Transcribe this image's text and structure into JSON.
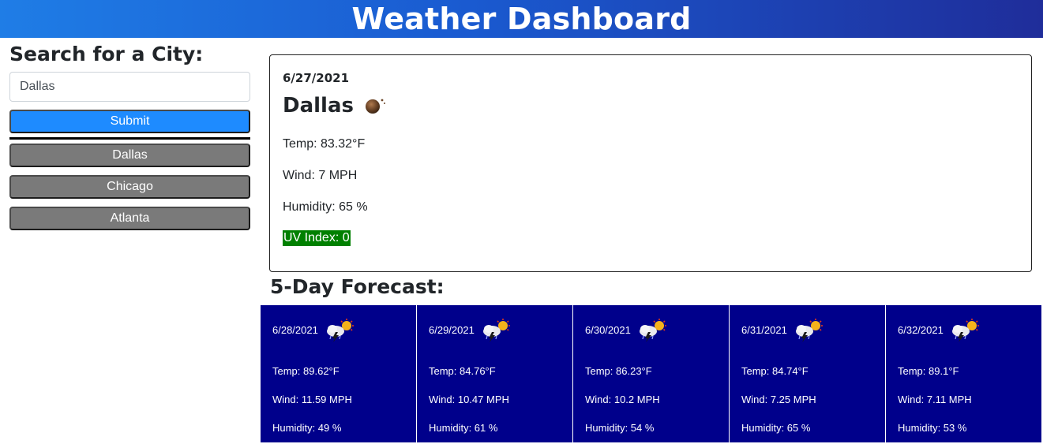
{
  "header": {
    "title": "Weather Dashboard"
  },
  "sidebar": {
    "heading": "Search for a City:",
    "search_value": "Dallas",
    "search_placeholder": "Dallas",
    "submit_label": "Submit",
    "history": [
      "Dallas",
      "Chicago",
      "Atlanta"
    ]
  },
  "current": {
    "date": "6/27/2021",
    "city": "Dallas",
    "icon": "clear-night-moon-icon",
    "temp": "Temp: 83.32°F",
    "wind": "Wind: 7 MPH",
    "humidity": "Humidity: 65 %",
    "uv": "UV Index: 0",
    "uv_color": "#008000"
  },
  "forecast": {
    "title": "5-Day Forecast:",
    "card_color": "#00008b",
    "days": [
      {
        "date": "6/28/2021",
        "icon": "thunderstorm-sun-icon",
        "temp": "Temp: 89.62°F",
        "wind": "Wind: 11.59 MPH",
        "humidity": "Humidity: 49 %"
      },
      {
        "date": "6/29/2021",
        "icon": "thunderstorm-sun-icon",
        "temp": "Temp: 84.76°F",
        "wind": "Wind: 10.47 MPH",
        "humidity": "Humidity: 61 %"
      },
      {
        "date": "6/30/2021",
        "icon": "thunderstorm-sun-icon",
        "temp": "Temp: 86.23°F",
        "wind": "Wind: 10.2 MPH",
        "humidity": "Humidity: 54 %"
      },
      {
        "date": "6/31/2021",
        "icon": "thunderstorm-sun-icon",
        "temp": "Temp: 84.74°F",
        "wind": "Wind: 7.25 MPH",
        "humidity": "Humidity: 65 %"
      },
      {
        "date": "6/32/2021",
        "icon": "thunderstorm-sun-icon",
        "temp": "Temp: 89.1°F",
        "wind": "Wind: 7.11 MPH",
        "humidity": "Humidity: 53 %"
      }
    ]
  }
}
